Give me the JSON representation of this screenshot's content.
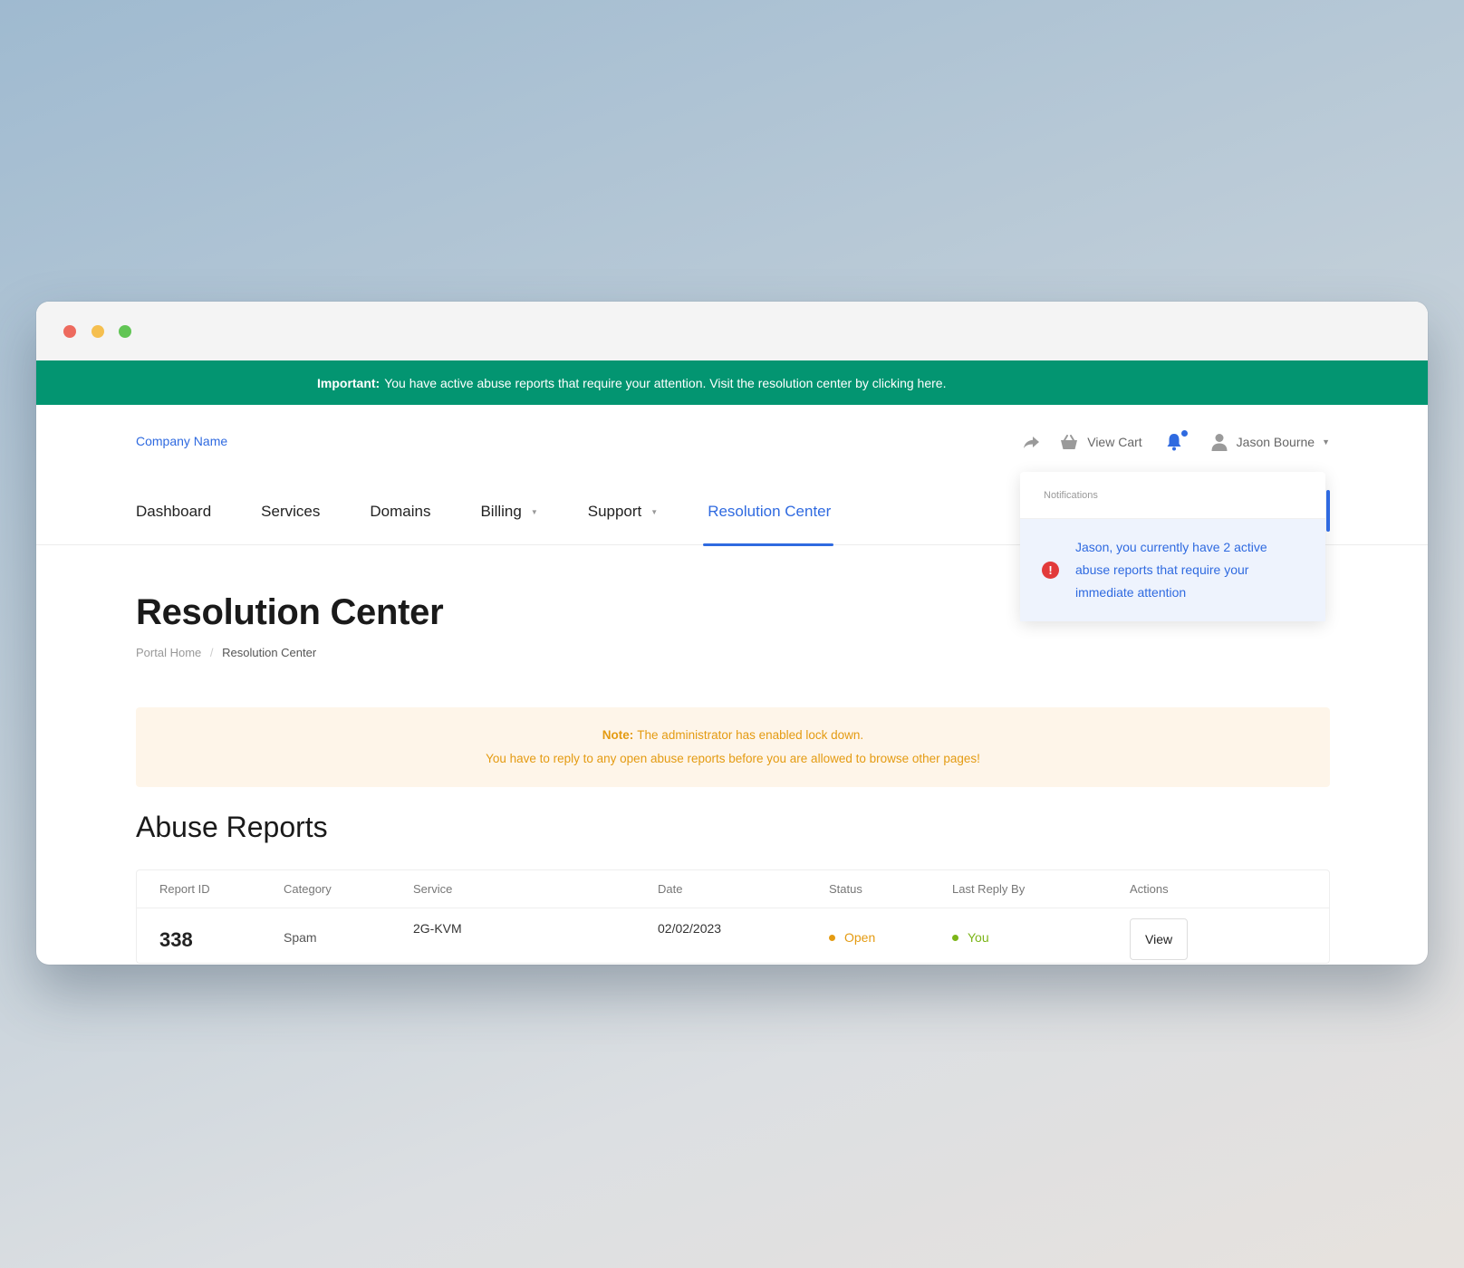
{
  "announcement": {
    "label": "Important:",
    "text": "You have active abuse reports that require your attention. Visit the resolution center by clicking here."
  },
  "brand": "Company Name",
  "header": {
    "view_cart": "View Cart",
    "user_name": "Jason Bourne"
  },
  "nav": {
    "dashboard": "Dashboard",
    "services": "Services",
    "domains": "Domains",
    "billing": "Billing",
    "support": "Support",
    "resolution_center": "Resolution Center"
  },
  "notifications": {
    "title": "Notifications",
    "message": "Jason, you currently have 2 active abuse reports that require your immediate attention",
    "icon": "!"
  },
  "page": {
    "title": "Resolution Center",
    "breadcrumb": {
      "home": "Portal Home",
      "separator": "/",
      "current": "Resolution Center"
    }
  },
  "note": {
    "label": "Note:",
    "line1": "The administrator has enabled lock down.",
    "line2": "You have to reply to any open abuse reports before you are allowed to browse other pages!"
  },
  "abuse_reports": {
    "title": "Abuse Reports",
    "columns": [
      "Report ID",
      "Category",
      "Service",
      "Date",
      "Status",
      "Last Reply By",
      "Actions"
    ],
    "rows": [
      {
        "report_id": "338",
        "category": "Spam",
        "service": "2G-KVM",
        "date": "02/02/2023",
        "status": "Open",
        "last_reply_by": "You",
        "action": "View"
      }
    ]
  },
  "colors": {
    "accent": "#2f6ae0",
    "announcement_bg": "#039571",
    "note_bg": "#fef5e9",
    "note_text": "#e49b12",
    "status_open": "#e49b12",
    "reply_you": "#7cb518",
    "alert": "#e23a3a"
  }
}
